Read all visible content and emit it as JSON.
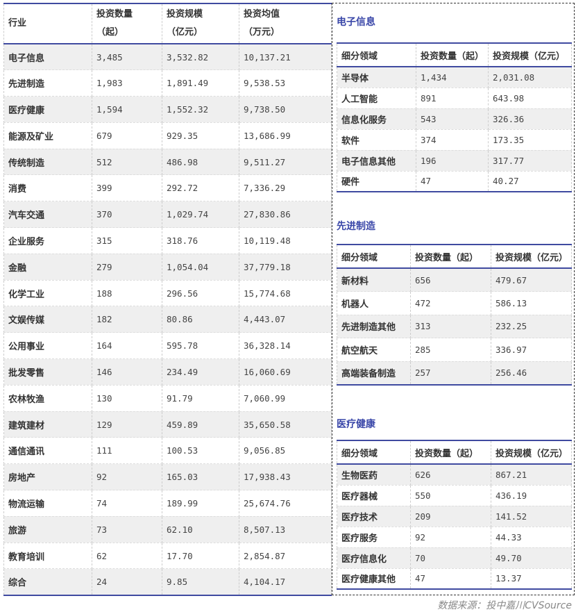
{
  "main_table": {
    "headers": [
      [
        "行业",
        ""
      ],
      [
        "投资数量",
        "（起）"
      ],
      [
        "投资规模",
        "（亿元）"
      ],
      [
        "投资均值",
        "（万元）"
      ]
    ],
    "rows": [
      [
        "电子信息",
        "3,485",
        "3,532.82",
        "10,137.21"
      ],
      [
        "先进制造",
        "1,983",
        "1,891.49",
        "9,538.53"
      ],
      [
        "医疗健康",
        "1,594",
        "1,552.32",
        "9,738.50"
      ],
      [
        "能源及矿业",
        "679",
        "929.35",
        "13,686.99"
      ],
      [
        "传统制造",
        "512",
        "486.98",
        "9,511.27"
      ],
      [
        "消费",
        "399",
        "292.72",
        "7,336.29"
      ],
      [
        "汽车交通",
        "370",
        "1,029.74",
        "27,830.86"
      ],
      [
        "企业服务",
        "315",
        "318.76",
        "10,119.48"
      ],
      [
        "金融",
        "279",
        "1,054.04",
        "37,779.18"
      ],
      [
        "化学工业",
        "188",
        "296.56",
        "15,774.68"
      ],
      [
        "文娱传媒",
        "182",
        "80.86",
        "4,443.07"
      ],
      [
        "公用事业",
        "164",
        "595.78",
        "36,328.14"
      ],
      [
        "批发零售",
        "146",
        "234.49",
        "16,060.69"
      ],
      [
        "农林牧渔",
        "130",
        "91.79",
        "7,060.99"
      ],
      [
        "建筑建材",
        "129",
        "459.89",
        "35,650.58"
      ],
      [
        "通信通讯",
        "111",
        "100.53",
        "9,056.85"
      ],
      [
        "房地产",
        "92",
        "165.03",
        "17,938.43"
      ],
      [
        "物流运输",
        "74",
        "189.99",
        "25,674.76"
      ],
      [
        "旅游",
        "73",
        "62.10",
        "8,507.13"
      ],
      [
        "教育培训",
        "62",
        "17.70",
        "2,854.87"
      ],
      [
        "综合",
        "24",
        "9.85",
        "4,104.17"
      ]
    ]
  },
  "sections": [
    {
      "title": "电子信息",
      "headers": [
        "细分领域",
        "投资数量（起）",
        "投资规模（亿元）"
      ],
      "rows": [
        [
          "半导体",
          "1,434",
          "2,031.08"
        ],
        [
          "人工智能",
          "891",
          "643.98"
        ],
        [
          "信息化服务",
          "543",
          "326.36"
        ],
        [
          "软件",
          "374",
          "173.35"
        ],
        [
          "电子信息其他",
          "196",
          "317.77"
        ],
        [
          "硬件",
          "47",
          "40.27"
        ]
      ]
    },
    {
      "title": "先进制造",
      "headers": [
        "细分领域",
        "投资数量（起）",
        "投资规模（亿元）"
      ],
      "rows": [
        [
          "新材料",
          "656",
          "479.67"
        ],
        [
          "机器人",
          "472",
          "586.13"
        ],
        [
          "先进制造其他",
          "313",
          "232.25"
        ],
        [
          "航空航天",
          "285",
          "336.97"
        ],
        [
          "高端装备制造",
          "257",
          "256.46"
        ]
      ]
    },
    {
      "title": "医疗健康",
      "headers": [
        "细分领域",
        "投资数量（起）",
        "投资规模（亿元）"
      ],
      "rows": [
        [
          "生物医药",
          "626",
          "867.21"
        ],
        [
          "医疗器械",
          "550",
          "436.19"
        ],
        [
          "医疗技术",
          "209",
          "141.52"
        ],
        [
          "医疗服务",
          "92",
          "44.33"
        ],
        [
          "医疗信息化",
          "70",
          "49.70"
        ],
        [
          "医疗健康其他",
          "47",
          "13.37"
        ]
      ]
    }
  ],
  "source": "数据来源：投中嘉川CVSource",
  "colors": {
    "accent": "#3f4aa0",
    "title": "#3946a8",
    "stripe": "#efefef"
  }
}
